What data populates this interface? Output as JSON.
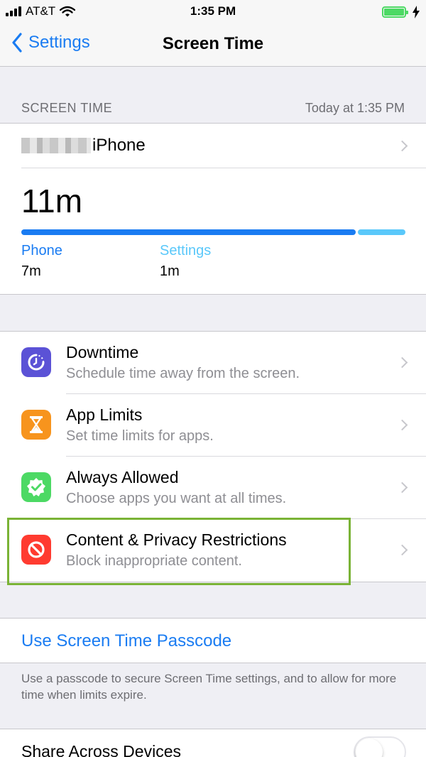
{
  "status_bar": {
    "carrier": "AT&T",
    "time": "1:35 PM"
  },
  "nav": {
    "back_label": "Settings",
    "title": "Screen Time"
  },
  "summary": {
    "section_label": "SCREEN TIME",
    "timestamp": "Today at 1:35 PM",
    "device_name": "iPhone",
    "total": "11m",
    "apps": [
      {
        "name": "Phone",
        "time": "7m",
        "color": "#1a7cf2",
        "minutes": 7
      },
      {
        "name": "Settings",
        "time": "1m",
        "color": "#5ac8fa",
        "minutes": 1
      }
    ]
  },
  "features": [
    {
      "title": "Downtime",
      "subtitle": "Schedule time away from the screen.",
      "icon": "downtime-icon",
      "color": "#5b52d6"
    },
    {
      "title": "App Limits",
      "subtitle": "Set time limits for apps.",
      "icon": "hourglass-icon",
      "color": "#f7941d"
    },
    {
      "title": "Always Allowed",
      "subtitle": "Choose apps you want at all times.",
      "icon": "checkmark-badge-icon",
      "color": "#4cd964"
    },
    {
      "title": "Content & Privacy Restrictions",
      "subtitle": "Block inappropriate content.",
      "icon": "restricted-icon",
      "color": "#ff3b30"
    }
  ],
  "passcode": {
    "label": "Use Screen Time Passcode",
    "note": "Use a passcode to secure Screen Time settings, and to allow for more time when limits expire."
  },
  "share": {
    "label": "Share Across Devices",
    "enabled": false
  },
  "colors": {
    "accent": "#1a7cf2",
    "highlight": "#7ab336"
  }
}
